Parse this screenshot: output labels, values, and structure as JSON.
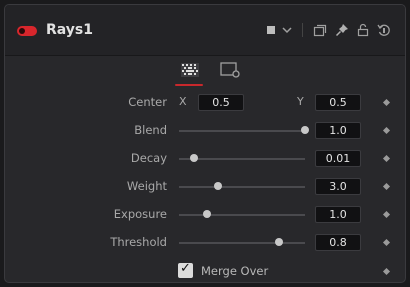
{
  "node": {
    "title": "Rays1",
    "accent": "#d8262c"
  },
  "header_icons": [
    "color-swatch-icon",
    "chevron-down-icon",
    "versions-icon",
    "pin-icon",
    "lock-icon",
    "reset-icon"
  ],
  "tabs": [
    {
      "name": "controls-tab",
      "active": true
    },
    {
      "name": "settings-tab",
      "active": false
    }
  ],
  "center": {
    "label": "Center",
    "x_label": "X",
    "x_value": "0.5",
    "y_label": "Y",
    "y_value": "0.5"
  },
  "sliders": [
    {
      "label": "Blend",
      "value": "1.0",
      "level": 1.0
    },
    {
      "label": "Decay",
      "value": "0.01",
      "level": 0.12
    },
    {
      "label": "Weight",
      "value": "3.0",
      "level": 0.31
    },
    {
      "label": "Exposure",
      "value": "1.0",
      "level": 0.22
    },
    {
      "label": "Threshold",
      "value": "0.8",
      "level": 0.79
    }
  ],
  "merge_over": {
    "label": "Merge Over",
    "checked": true
  }
}
